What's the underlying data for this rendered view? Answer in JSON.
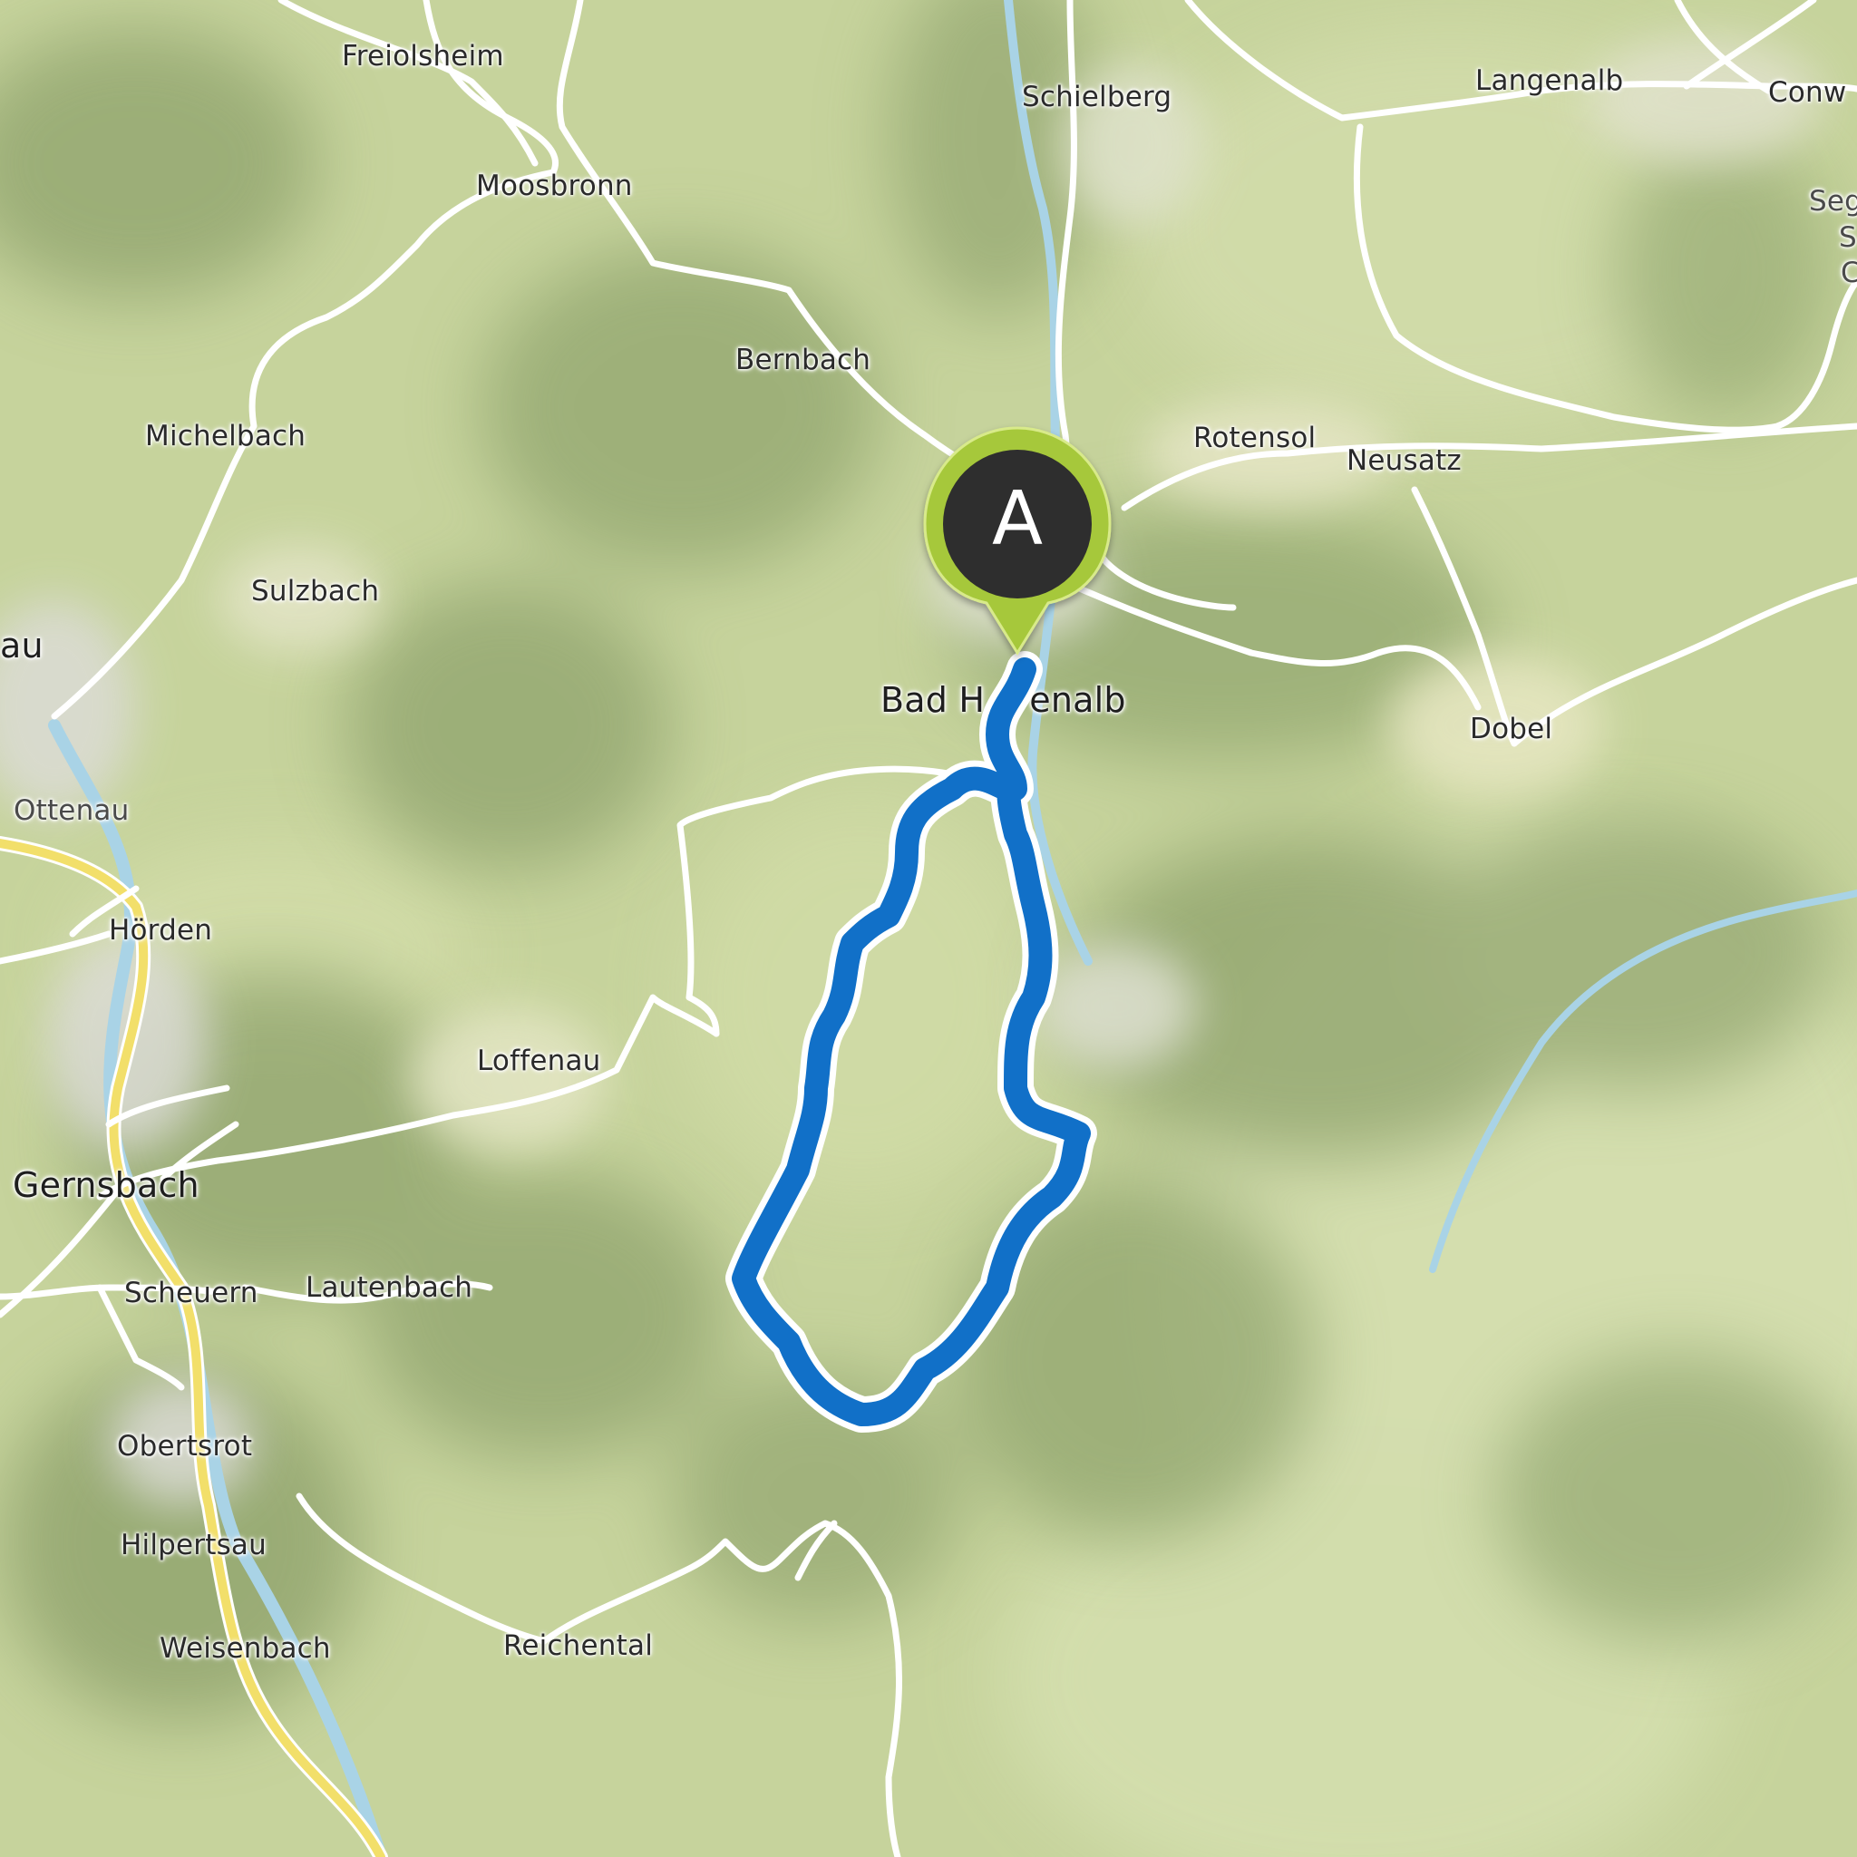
{
  "map": {
    "places": [
      {
        "name": "Freiolsheim"
      },
      {
        "name": "Schielberg"
      },
      {
        "name": "Langenalb"
      },
      {
        "name": "Conw"
      },
      {
        "name": "Seg"
      },
      {
        "name": "S"
      },
      {
        "name": "C"
      },
      {
        "name": "Moosbronn"
      },
      {
        "name": "Bernbach"
      },
      {
        "name": "Michelbach"
      },
      {
        "name": "Rotensol"
      },
      {
        "name": "Neusatz"
      },
      {
        "name": "Sulzbach"
      },
      {
        "name": "au"
      },
      {
        "name": "Bad H    enalb"
      },
      {
        "name": "Dobel"
      },
      {
        "name": "Ottenau"
      },
      {
        "name": "Hörden"
      },
      {
        "name": "Loffenau"
      },
      {
        "name": "Gernsbach"
      },
      {
        "name": "Scheuern"
      },
      {
        "name": "Lautenbach"
      },
      {
        "name": "Obertsrot"
      },
      {
        "name": "Hilpertsau"
      },
      {
        "name": "Reichental"
      },
      {
        "name": "Weisenbach"
      }
    ],
    "start_marker": {
      "label": "A",
      "icon": "map-pin-icon",
      "color": "#a6c83a",
      "inner_color": "#2d2d2d"
    },
    "route": {
      "color": "#1170c8",
      "type": "loop"
    },
    "colors": {
      "terrain": "#c9d6a0",
      "road": "#ffffff",
      "main_road": "#f2df6a",
      "river": "#a8d6ea"
    }
  }
}
